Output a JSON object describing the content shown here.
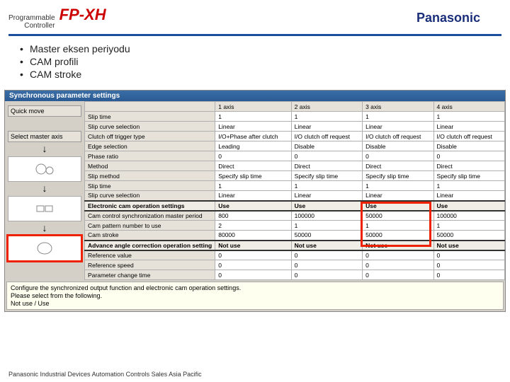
{
  "header": {
    "prog_ctrl_line1": "Programmable",
    "prog_ctrl_line2": "Controller",
    "product": "FP-XH",
    "brand": "Panasonic"
  },
  "bullets": [
    "Master eksen periyodu",
    "CAM profili",
    "CAM stroke"
  ],
  "window": {
    "title": "Synchronous parameter settings",
    "quick_move": "Quick move",
    "select_master": "Select master axis",
    "columns": [
      "",
      "1 axis",
      "2 axis",
      "3 axis",
      "4 axis"
    ],
    "rowLabels": [
      "Slip time",
      "Slip curve selection",
      "Clutch off trigger type",
      "Edge selection",
      "Phase ratio",
      "Method",
      "Slip method",
      "Slip time",
      "Slip curve selection"
    ],
    "rows": [
      [
        "1",
        "1",
        "1",
        "1"
      ],
      [
        "Linear",
        "Linear",
        "Linear",
        "Linear"
      ],
      [
        "I/O+Phase after clutch",
        "I/O clutch off request",
        "I/O clutch off request",
        "I/O clutch off request"
      ],
      [
        "Leading",
        "Disable",
        "Disable",
        "Disable"
      ],
      [
        "0",
        "0",
        "0",
        "0"
      ],
      [
        "Direct",
        "Direct",
        "Direct",
        "Direct"
      ],
      [
        "Specify slip time",
        "Specify slip time",
        "Specify slip time",
        "Specify slip time"
      ],
      [
        "1",
        "1",
        "1",
        "1"
      ],
      [
        "Linear",
        "Linear",
        "Linear",
        "Linear"
      ]
    ],
    "cam_header": "Electronic cam operation settings",
    "cam_use": [
      "Use",
      "Use",
      "Use",
      "Use"
    ],
    "camLabels": [
      "Cam control synchronization master period",
      "Cam pattern number to use",
      "Cam stroke"
    ],
    "cam_rows": [
      [
        "800",
        "100000",
        "50000",
        "100000"
      ],
      [
        "2",
        "1",
        "1",
        "1"
      ],
      [
        "80000",
        "50000",
        "50000",
        "50000"
      ]
    ],
    "advLabel": "Advance angle correction operation setting",
    "adv_row": [
      "Not use",
      "Not use",
      "Not use",
      "Not use"
    ],
    "refLabels": [
      "Reference value",
      "Reference speed",
      "Parameter change time"
    ],
    "ref_rows": [
      [
        "0",
        "0",
        "0",
        "0"
      ],
      [
        "0",
        "0",
        "0",
        "0"
      ],
      [
        "0",
        "0",
        "0",
        "0"
      ]
    ],
    "hint1": "Configure the synchronized output function and electronic cam operation settings.",
    "hint2": "Please select from the following.",
    "hint3": "Not use / Use"
  },
  "footer": "Panasonic Industrial Devices Automation Controls Sales Asia Pacific"
}
